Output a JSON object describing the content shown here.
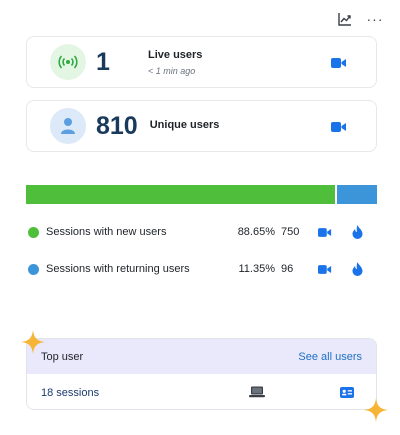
{
  "toolbar": {
    "chart_icon": "trend-chart-icon",
    "more_icon": "more-horizontal-icon",
    "more_label": "···"
  },
  "live_users": {
    "value": "1",
    "label": "Live users",
    "sub": "< 1 min ago",
    "icon": "live-signal-icon",
    "accent": "#2eaa42",
    "icon_bg": "#e3f5e3"
  },
  "unique_users": {
    "value": "810",
    "label": "Unique users",
    "icon": "user-icon",
    "accent": "#5b9fe0",
    "icon_bg": "#dbe9f8"
  },
  "sessions": {
    "new_ratio": 0.8865,
    "items": [
      {
        "name": "Sessions with new users",
        "pct": "88.65%",
        "count": "750",
        "color": "#4fbe3a"
      },
      {
        "name": "Sessions with returning users",
        "pct": "11.35%",
        "count": "96",
        "color": "#3d95d9"
      }
    ]
  },
  "top_user": {
    "title": "Top user",
    "link": "See all users",
    "sessions": "18 sessions",
    "header_bg": "#e9e9fb"
  },
  "colors": {
    "action_blue": "#1a73e8",
    "sparkle": "#f7b538"
  }
}
